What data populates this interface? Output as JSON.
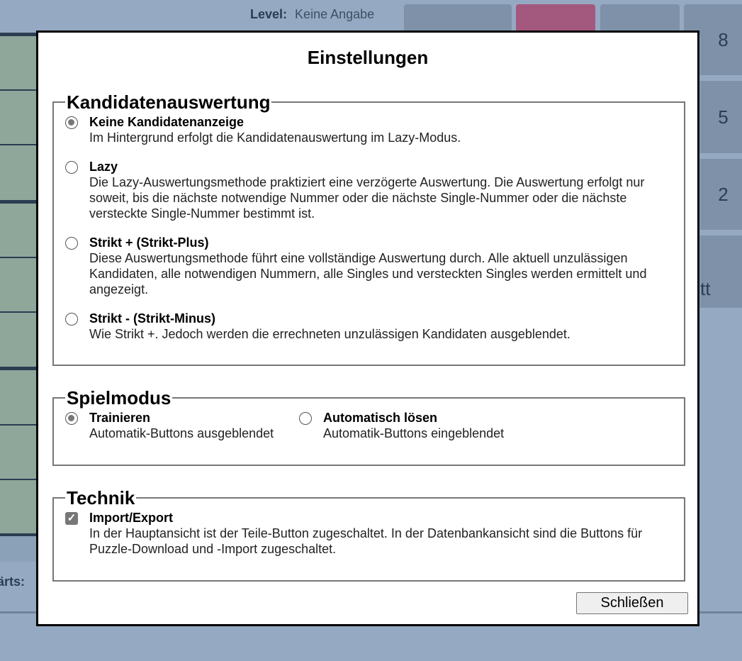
{
  "background": {
    "level_label": "Level:",
    "level_value": "Keine Angabe",
    "left_label": "ärts:",
    "right_numbers": [
      "8",
      "5",
      "2",
      "tt"
    ]
  },
  "dialog": {
    "title": "Einstellungen",
    "close_label": "Schließen",
    "sections": {
      "kandidaten": {
        "legend": "Kandidatenauswertung",
        "options": [
          {
            "title": "Keine Kandidatenanzeige",
            "desc": "Im Hintergrund erfolgt die Kandidatenauswertung im Lazy-Modus.",
            "selected": true
          },
          {
            "title": "Lazy",
            "desc": "Die Lazy-Auswertungsmethode praktiziert eine verzögerte Auswertung. Die Auswertung erfolgt nur soweit, bis die nächste notwendige Nummer oder die nächste Single-Nummer oder die nächste versteckte Single-Nummer bestimmt ist.",
            "selected": false
          },
          {
            "title": "Strikt + (Strikt-Plus)",
            "desc": "Diese Auswertungsmethode führt eine vollständige Auswertung durch. Alle aktuell unzulässigen Kandidaten, alle notwendigen Nummern, alle Singles und versteckten Singles werden ermittelt und angezeigt.",
            "selected": false
          },
          {
            "title": "Strikt - (Strikt-Minus)",
            "desc": "Wie Strikt +. Jedoch werden die errechneten unzulässigen Kandidaten ausgeblendet.",
            "selected": false
          }
        ]
      },
      "spielmodus": {
        "legend": "Spielmodus",
        "options": [
          {
            "title": "Trainieren",
            "desc": "Automatik-Buttons ausgeblendet",
            "selected": true
          },
          {
            "title": "Automatisch lösen",
            "desc": "Automatik-Buttons eingeblendet",
            "selected": false
          }
        ]
      },
      "technik": {
        "legend": "Technik",
        "options": [
          {
            "title": "Import/Export",
            "desc": "In der Hauptansicht ist der Teile-Button zugeschaltet. In der Datenbankansicht sind die Buttons für Puzzle-Download und -Import zugeschaltet.",
            "checked": true
          }
        ]
      }
    }
  }
}
